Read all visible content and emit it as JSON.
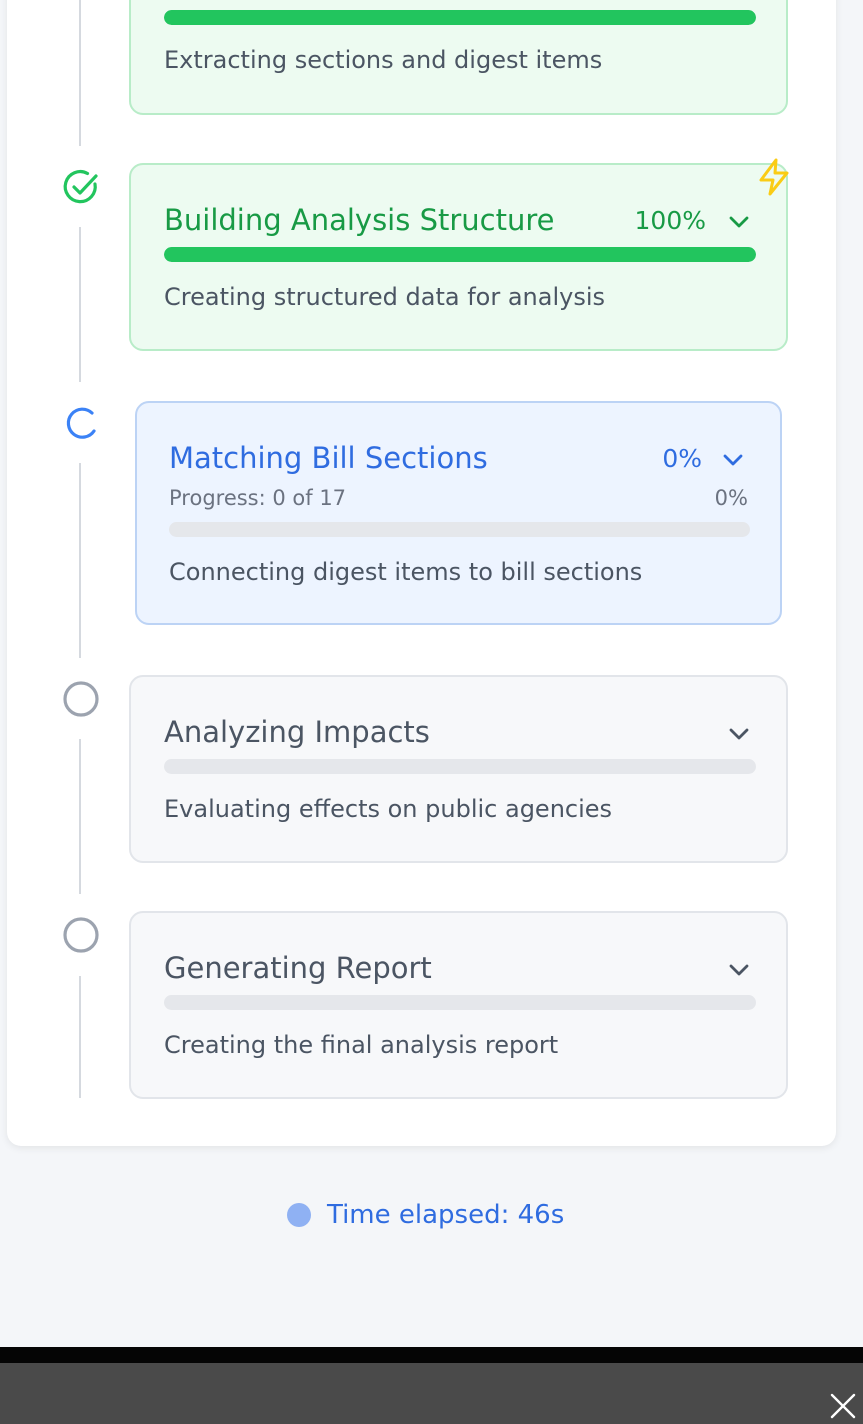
{
  "steps": [
    {
      "state": "done",
      "title": "",
      "percent": "",
      "progress": 1.0,
      "description": "Extracting sections and digest items"
    },
    {
      "state": "done",
      "title": "Building Analysis Structure",
      "percent": "100%",
      "progress": 1.0,
      "description": "Creating structured data for analysis",
      "badge_icon": "lightning-icon"
    },
    {
      "state": "active",
      "title": "Matching Bill Sections",
      "percent": "0%",
      "progress": 0.0,
      "progress_label": "Progress: 0 of 17",
      "progress_pct": "0%",
      "description": "Connecting digest items to bill sections"
    },
    {
      "state": "pending",
      "title": "Analyzing Impacts",
      "percent": "",
      "progress": 0.0,
      "description": "Evaluating effects on public agencies"
    },
    {
      "state": "pending",
      "title": "Generating Report",
      "percent": "",
      "progress": 0.0,
      "description": "Creating the final analysis report"
    }
  ],
  "elapsed": {
    "label": "Time elapsed: 46s"
  },
  "colors": {
    "done": "#22c55e",
    "active": "#3b82f6",
    "pending": "#9ca3af",
    "accent_icon": "#facc15"
  }
}
